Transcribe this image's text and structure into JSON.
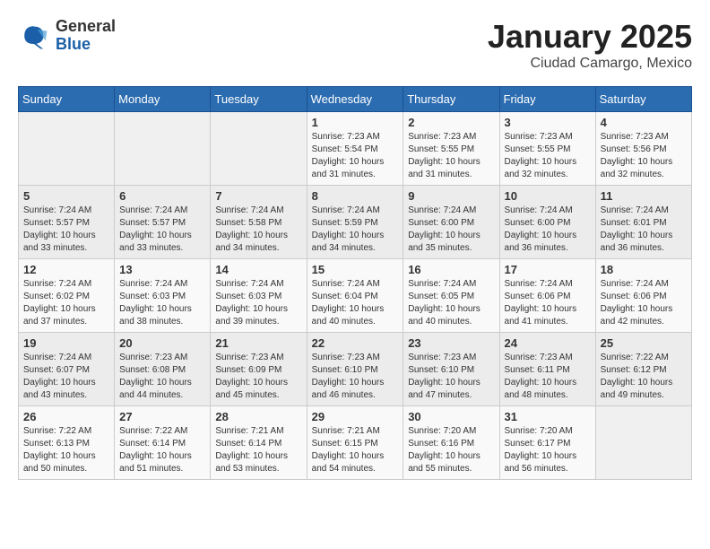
{
  "header": {
    "logo_general": "General",
    "logo_blue": "Blue",
    "month_title": "January 2025",
    "location": "Ciudad Camargo, Mexico"
  },
  "weekdays": [
    "Sunday",
    "Monday",
    "Tuesday",
    "Wednesday",
    "Thursday",
    "Friday",
    "Saturday"
  ],
  "weeks": [
    [
      {
        "day": "",
        "info": ""
      },
      {
        "day": "",
        "info": ""
      },
      {
        "day": "",
        "info": ""
      },
      {
        "day": "1",
        "info": "Sunrise: 7:23 AM\nSunset: 5:54 PM\nDaylight: 10 hours\nand 31 minutes."
      },
      {
        "day": "2",
        "info": "Sunrise: 7:23 AM\nSunset: 5:55 PM\nDaylight: 10 hours\nand 31 minutes."
      },
      {
        "day": "3",
        "info": "Sunrise: 7:23 AM\nSunset: 5:55 PM\nDaylight: 10 hours\nand 32 minutes."
      },
      {
        "day": "4",
        "info": "Sunrise: 7:23 AM\nSunset: 5:56 PM\nDaylight: 10 hours\nand 32 minutes."
      }
    ],
    [
      {
        "day": "5",
        "info": "Sunrise: 7:24 AM\nSunset: 5:57 PM\nDaylight: 10 hours\nand 33 minutes."
      },
      {
        "day": "6",
        "info": "Sunrise: 7:24 AM\nSunset: 5:57 PM\nDaylight: 10 hours\nand 33 minutes."
      },
      {
        "day": "7",
        "info": "Sunrise: 7:24 AM\nSunset: 5:58 PM\nDaylight: 10 hours\nand 34 minutes."
      },
      {
        "day": "8",
        "info": "Sunrise: 7:24 AM\nSunset: 5:59 PM\nDaylight: 10 hours\nand 34 minutes."
      },
      {
        "day": "9",
        "info": "Sunrise: 7:24 AM\nSunset: 6:00 PM\nDaylight: 10 hours\nand 35 minutes."
      },
      {
        "day": "10",
        "info": "Sunrise: 7:24 AM\nSunset: 6:00 PM\nDaylight: 10 hours\nand 36 minutes."
      },
      {
        "day": "11",
        "info": "Sunrise: 7:24 AM\nSunset: 6:01 PM\nDaylight: 10 hours\nand 36 minutes."
      }
    ],
    [
      {
        "day": "12",
        "info": "Sunrise: 7:24 AM\nSunset: 6:02 PM\nDaylight: 10 hours\nand 37 minutes."
      },
      {
        "day": "13",
        "info": "Sunrise: 7:24 AM\nSunset: 6:03 PM\nDaylight: 10 hours\nand 38 minutes."
      },
      {
        "day": "14",
        "info": "Sunrise: 7:24 AM\nSunset: 6:03 PM\nDaylight: 10 hours\nand 39 minutes."
      },
      {
        "day": "15",
        "info": "Sunrise: 7:24 AM\nSunset: 6:04 PM\nDaylight: 10 hours\nand 40 minutes."
      },
      {
        "day": "16",
        "info": "Sunrise: 7:24 AM\nSunset: 6:05 PM\nDaylight: 10 hours\nand 40 minutes."
      },
      {
        "day": "17",
        "info": "Sunrise: 7:24 AM\nSunset: 6:06 PM\nDaylight: 10 hours\nand 41 minutes."
      },
      {
        "day": "18",
        "info": "Sunrise: 7:24 AM\nSunset: 6:06 PM\nDaylight: 10 hours\nand 42 minutes."
      }
    ],
    [
      {
        "day": "19",
        "info": "Sunrise: 7:24 AM\nSunset: 6:07 PM\nDaylight: 10 hours\nand 43 minutes."
      },
      {
        "day": "20",
        "info": "Sunrise: 7:23 AM\nSunset: 6:08 PM\nDaylight: 10 hours\nand 44 minutes."
      },
      {
        "day": "21",
        "info": "Sunrise: 7:23 AM\nSunset: 6:09 PM\nDaylight: 10 hours\nand 45 minutes."
      },
      {
        "day": "22",
        "info": "Sunrise: 7:23 AM\nSunset: 6:10 PM\nDaylight: 10 hours\nand 46 minutes."
      },
      {
        "day": "23",
        "info": "Sunrise: 7:23 AM\nSunset: 6:10 PM\nDaylight: 10 hours\nand 47 minutes."
      },
      {
        "day": "24",
        "info": "Sunrise: 7:23 AM\nSunset: 6:11 PM\nDaylight: 10 hours\nand 48 minutes."
      },
      {
        "day": "25",
        "info": "Sunrise: 7:22 AM\nSunset: 6:12 PM\nDaylight: 10 hours\nand 49 minutes."
      }
    ],
    [
      {
        "day": "26",
        "info": "Sunrise: 7:22 AM\nSunset: 6:13 PM\nDaylight: 10 hours\nand 50 minutes."
      },
      {
        "day": "27",
        "info": "Sunrise: 7:22 AM\nSunset: 6:14 PM\nDaylight: 10 hours\nand 51 minutes."
      },
      {
        "day": "28",
        "info": "Sunrise: 7:21 AM\nSunset: 6:14 PM\nDaylight: 10 hours\nand 53 minutes."
      },
      {
        "day": "29",
        "info": "Sunrise: 7:21 AM\nSunset: 6:15 PM\nDaylight: 10 hours\nand 54 minutes."
      },
      {
        "day": "30",
        "info": "Sunrise: 7:20 AM\nSunset: 6:16 PM\nDaylight: 10 hours\nand 55 minutes."
      },
      {
        "day": "31",
        "info": "Sunrise: 7:20 AM\nSunset: 6:17 PM\nDaylight: 10 hours\nand 56 minutes."
      },
      {
        "day": "",
        "info": ""
      }
    ]
  ]
}
